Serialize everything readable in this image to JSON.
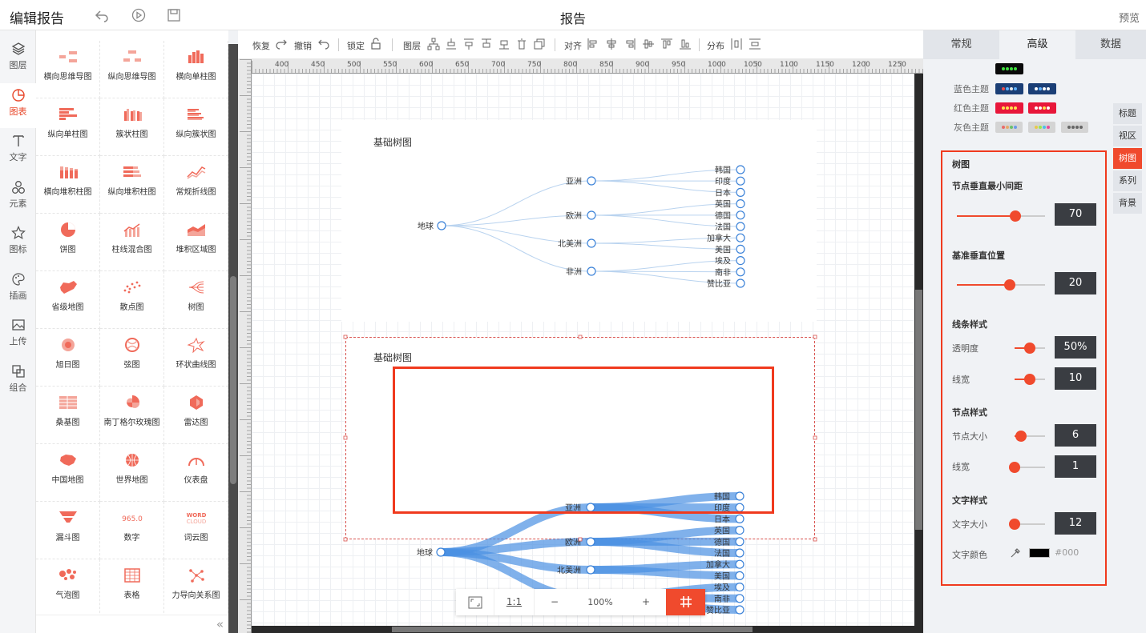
{
  "topbar": {
    "title": "编辑报告",
    "center_title": "报告",
    "preview": "预览"
  },
  "leftnav": [
    {
      "label": "图层",
      "icon": "layers-icon"
    },
    {
      "label": "图表",
      "icon": "chart-pie-icon"
    },
    {
      "label": "文字",
      "icon": "text-icon"
    },
    {
      "label": "元素",
      "icon": "elements-icon"
    },
    {
      "label": "图标",
      "icon": "star-icon"
    },
    {
      "label": "插画",
      "icon": "palette-icon"
    },
    {
      "label": "上传",
      "icon": "upload-image-icon"
    },
    {
      "label": "组合",
      "icon": "group-icon"
    }
  ],
  "palette": [
    "横向思维导图",
    "纵向思维导图",
    "横向单柱图",
    "纵向单柱图",
    "簇状柱图",
    "纵向簇状图",
    "横向堆积柱图",
    "纵向堆积柱图",
    "常规折线图",
    "饼图",
    "柱线混合图",
    "堆积区域图",
    "省级地图",
    "散点图",
    "树图",
    "旭日图",
    "弦图",
    "环状曲线图",
    "桑基图",
    "南丁格尔玫瑰图",
    "雷达图",
    "中国地图",
    "世界地图",
    "仪表盘",
    "漏斗图",
    "数字",
    "词云图",
    "气泡图",
    "表格",
    "力导向关系图"
  ],
  "toolbar": {
    "redo": "恢复",
    "undo": "撤销",
    "lock": "锁定",
    "layer": "图层",
    "align": "对齐",
    "distribute": "分布"
  },
  "ruler_ticks": [
    "400",
    "450",
    "500",
    "550",
    "600",
    "650",
    "700",
    "750",
    "800",
    "850",
    "900",
    "950",
    "1000",
    "1050",
    "1100",
    "1150",
    "1200",
    "1250"
  ],
  "canvas": {
    "chart1_title": "基础树图",
    "chart2_title": "基础树图"
  },
  "tree": {
    "root": "地球",
    "continents": [
      "亚洲",
      "欧洲",
      "北美洲",
      "非洲"
    ],
    "countries": [
      [
        "韩国",
        "印度",
        "日本"
      ],
      [
        "英国",
        "德国",
        "法国"
      ],
      [
        "加拿大",
        "美国"
      ],
      [
        "埃及",
        "南非",
        "赞比亚"
      ]
    ]
  },
  "zoom": {
    "fit": "fit-screen-icon",
    "one": "1:1",
    "minus": "−",
    "level": "100%",
    "plus": "+"
  },
  "rpanel": {
    "tabs": [
      "常规",
      "高级",
      "数据"
    ],
    "themes": [
      {
        "label": "",
        "swatches": [
          {
            "bg": "#0a0a0a",
            "dots": [
              "#3fe03f",
              "#3fe03f",
              "#3fe03f",
              "#3fe03f"
            ]
          }
        ]
      },
      {
        "label": "蓝色主题",
        "swatches": [
          {
            "bg": "#1b3f76",
            "dots": [
              "#e84a4a",
              "#5fb2ff",
              "#e8e8e8",
              "#5fb2ff"
            ]
          },
          {
            "bg": "#1b3f76",
            "dots": [
              "#ffffff",
              "#5fb2ff",
              "#ffffff",
              "#ffffff"
            ]
          }
        ]
      },
      {
        "label": "红色主题",
        "swatches": [
          {
            "bg": "#e8173a",
            "dots": [
              "#ffe34d",
              "#ffe34d",
              "#ffe34d",
              "#ffe34d"
            ]
          },
          {
            "bg": "#e8173a",
            "dots": [
              "#ffffff",
              "#ffffff",
              "#ffe34d",
              "#ffffff"
            ]
          }
        ]
      },
      {
        "label": "灰色主题",
        "swatches": [
          {
            "bg": "#d4d4d4",
            "dots": [
              "#e86a6a",
              "#e8a86a",
              "#6ac06a",
              "#6a9ae8"
            ]
          },
          {
            "bg": "#d4d4d4",
            "dots": [
              "#e8c84a",
              "#9ae84a",
              "#4ac0e8",
              "#e84a9a"
            ]
          },
          {
            "bg": "#d4d4d4",
            "dots": [
              "#666666",
              "#666666",
              "#666666",
              "#666666"
            ]
          }
        ]
      }
    ],
    "sidetabs": [
      "标题",
      "视区",
      "树图",
      "系列",
      "背景"
    ],
    "tree_panel": {
      "title": "树图",
      "node_gap_label": "节点垂直最小间距",
      "node_gap": "70",
      "node_gap_pct": 0.66,
      "base_pos_label": "基准垂直位置",
      "base_pos": "20",
      "base_pos_pct": 0.6,
      "line_style_label": "线条样式",
      "opacity_label": "透明度",
      "opacity": "50%",
      "opacity_pct": 0.5,
      "line_width_label": "线宽",
      "line_width": "10",
      "line_width_pct": 0.5,
      "node_style_label": "节点样式",
      "node_size_label": "节点大小",
      "node_size": "6",
      "node_size_pct": 0.2,
      "node_line_label": "线宽",
      "node_line": "1",
      "node_line_pct": 0.0,
      "text_style_label": "文字样式",
      "font_size_label": "文字大小",
      "font_size": "12",
      "font_size_pct": 0.0,
      "font_color_label": "文字颜色",
      "font_color": "#000"
    }
  },
  "colors": {
    "accent": "#f04a2d",
    "tree_line": "#4a90e2",
    "node": "#3b82d8"
  }
}
